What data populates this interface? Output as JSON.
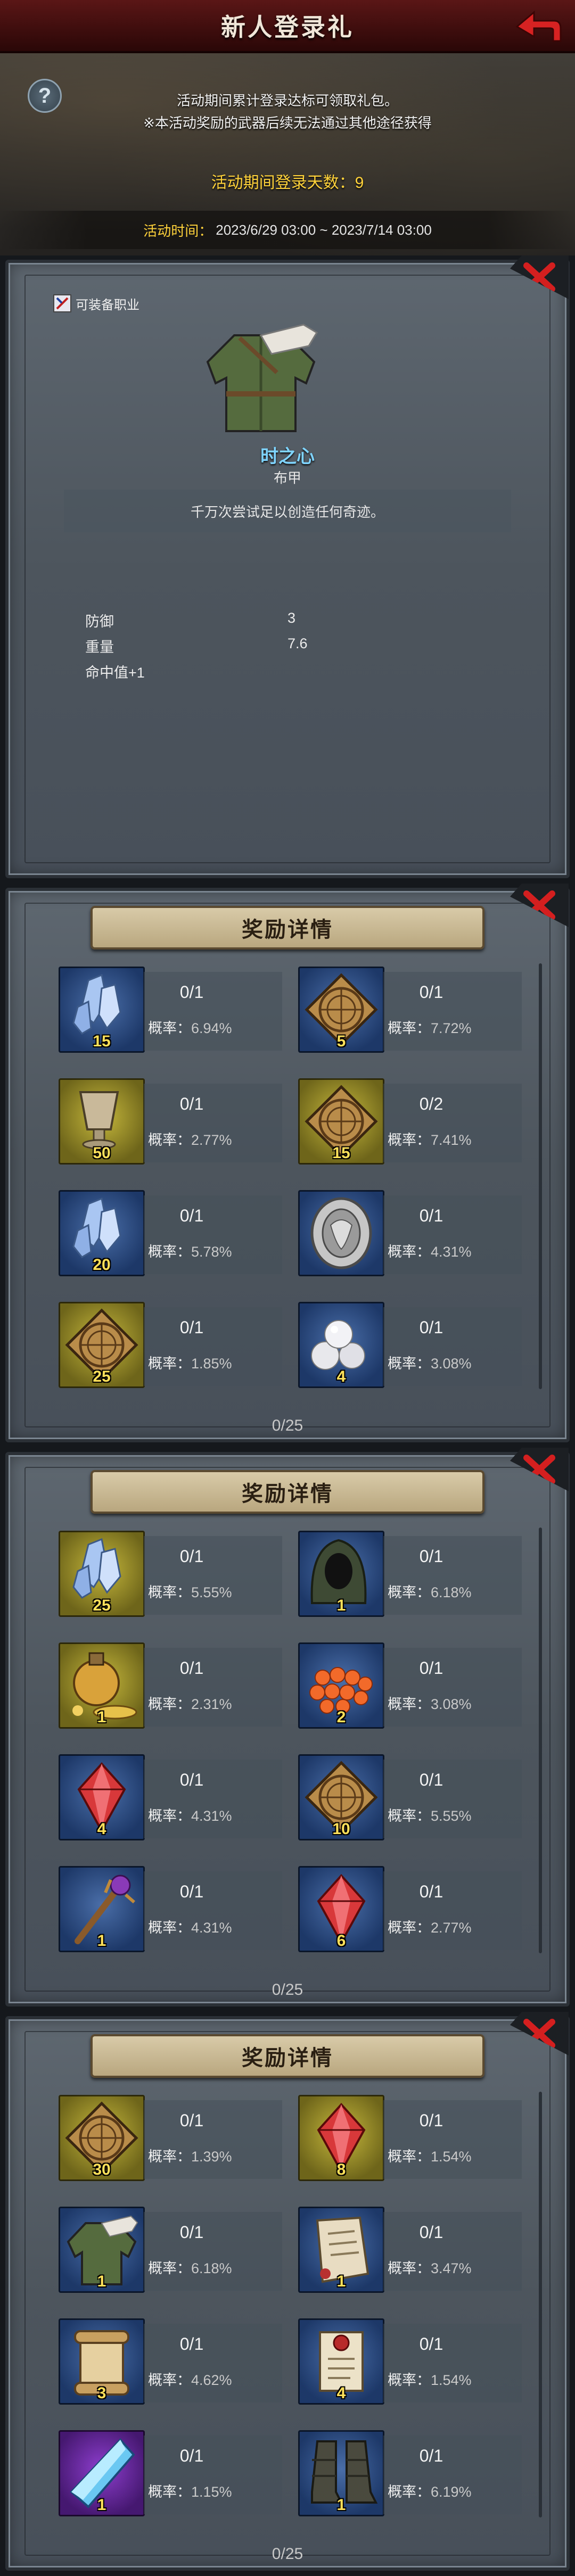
{
  "header": {
    "title": "新人登录礼"
  },
  "banner": {
    "line1": "活动期间累计登录达标可领取礼包。",
    "line2": "※本活动奖励的武器后续无法通过其他途径获得",
    "login_days_label": "活动期间登录天数：",
    "login_days_value": "9",
    "time_label": "活动时间：",
    "time_value": "2023/6/29 03:00 ~ 2023/7/14 03:00"
  },
  "item_detail": {
    "equip_tag": "可装备职业",
    "name": "时之心",
    "type": "布甲",
    "description": "千万次尝试足以创造任何奇迹。",
    "stats": [
      {
        "label": "防御",
        "value": "3"
      },
      {
        "label": "重量",
        "value": "7.6"
      },
      {
        "label": "命中值+1",
        "value": ""
      }
    ]
  },
  "reward_panels": [
    {
      "header": "奖励详情",
      "progress": "0/25",
      "items": [
        {
          "icon": "crystal-icon",
          "rarity": "blue",
          "qty": "15",
          "count": "0/1",
          "prob_label": "概率：",
          "prob": "6.94%"
        },
        {
          "icon": "rune-tile-icon",
          "rarity": "blue",
          "qty": "5",
          "count": "0/1",
          "prob_label": "概率：",
          "prob": "7.72%"
        },
        {
          "icon": "goblet-icon",
          "rarity": "yellow",
          "qty": "50",
          "count": "0/1",
          "prob_label": "概率：",
          "prob": "2.77%"
        },
        {
          "icon": "rune-tile-icon",
          "rarity": "yellow",
          "qty": "15",
          "count": "0/2",
          "prob_label": "概率：",
          "prob": "7.41%"
        },
        {
          "icon": "crystal-icon",
          "rarity": "blue",
          "qty": "20",
          "count": "0/1",
          "prob_label": "概率：",
          "prob": "5.78%"
        },
        {
          "icon": "silver-shield-icon",
          "rarity": "blue",
          "qty": "",
          "count": "0/1",
          "prob_label": "概率：",
          "prob": "4.31%"
        },
        {
          "icon": "rune-tile-icon",
          "rarity": "yellow",
          "qty": "25",
          "count": "0/1",
          "prob_label": "概率：",
          "prob": "1.85%"
        },
        {
          "icon": "pearls-icon",
          "rarity": "blue",
          "qty": "4",
          "count": "0/1",
          "prob_label": "概率：",
          "prob": "3.08%"
        }
      ]
    },
    {
      "header": "奖励详情",
      "progress": "0/25",
      "items": [
        {
          "icon": "crystal-icon",
          "rarity": "yellow",
          "qty": "25",
          "count": "0/1",
          "prob_label": "概率：",
          "prob": "5.55%"
        },
        {
          "icon": "hood-icon",
          "rarity": "blue",
          "qty": "1",
          "count": "0/1",
          "prob_label": "概率：",
          "prob": "6.18%"
        },
        {
          "icon": "potion-gold-icon",
          "rarity": "yellow",
          "qty": "1",
          "count": "0/1",
          "prob_label": "概率：",
          "prob": "2.31%"
        },
        {
          "icon": "orbs-icon",
          "rarity": "blue",
          "qty": "2",
          "count": "0/1",
          "prob_label": "概率：",
          "prob": "3.08%"
        },
        {
          "icon": "red-gem-icon",
          "rarity": "blue",
          "qty": "4",
          "count": "0/1",
          "prob_label": "概率：",
          "prob": "4.31%"
        },
        {
          "icon": "rune-tile-icon",
          "rarity": "blue",
          "qty": "10",
          "count": "0/1",
          "prob_label": "概率：",
          "prob": "5.55%"
        },
        {
          "icon": "staff-icon",
          "rarity": "blue",
          "qty": "1",
          "count": "0/1",
          "prob_label": "概率：",
          "prob": "4.31%"
        },
        {
          "icon": "red-gem-icon",
          "rarity": "blue",
          "qty": "6",
          "count": "0/1",
          "prob_label": "概率：",
          "prob": "2.77%"
        }
      ]
    },
    {
      "header": "奖励详情",
      "progress": "0/25",
      "items": [
        {
          "icon": "rune-tile-icon",
          "rarity": "yellow",
          "qty": "30",
          "count": "0/1",
          "prob_label": "概率：",
          "prob": "1.39%"
        },
        {
          "icon": "red-gem-icon",
          "rarity": "yellow",
          "qty": "8",
          "count": "0/1",
          "prob_label": "概率：",
          "prob": "1.54%"
        },
        {
          "icon": "robe-icon",
          "rarity": "blue",
          "qty": "1",
          "count": "0/1",
          "prob_label": "概率：",
          "prob": "6.18%"
        },
        {
          "icon": "map-scroll-icon",
          "rarity": "blue",
          "qty": "1",
          "count": "0/1",
          "prob_label": "概率：",
          "prob": "3.47%"
        },
        {
          "icon": "scroll-icon",
          "rarity": "blue",
          "qty": "3",
          "count": "0/1",
          "prob_label": "概率：",
          "prob": "4.62%"
        },
        {
          "icon": "sealed-scroll-icon",
          "rarity": "blue",
          "qty": "4",
          "count": "0/1",
          "prob_label": "概率：",
          "prob": "1.54%"
        },
        {
          "icon": "blue-crystal-icon",
          "rarity": "purple",
          "qty": "1",
          "count": "0/1",
          "prob_label": "概率：",
          "prob": "1.15%"
        },
        {
          "icon": "boots-icon",
          "rarity": "blue",
          "qty": "1",
          "count": "0/1",
          "prob_label": "概率：",
          "prob": "6.19%"
        }
      ]
    }
  ],
  "colors": {
    "accent_gold": "#ffd23a",
    "item_name": "#7fd4ff",
    "title_bar": "#5a1616"
  }
}
